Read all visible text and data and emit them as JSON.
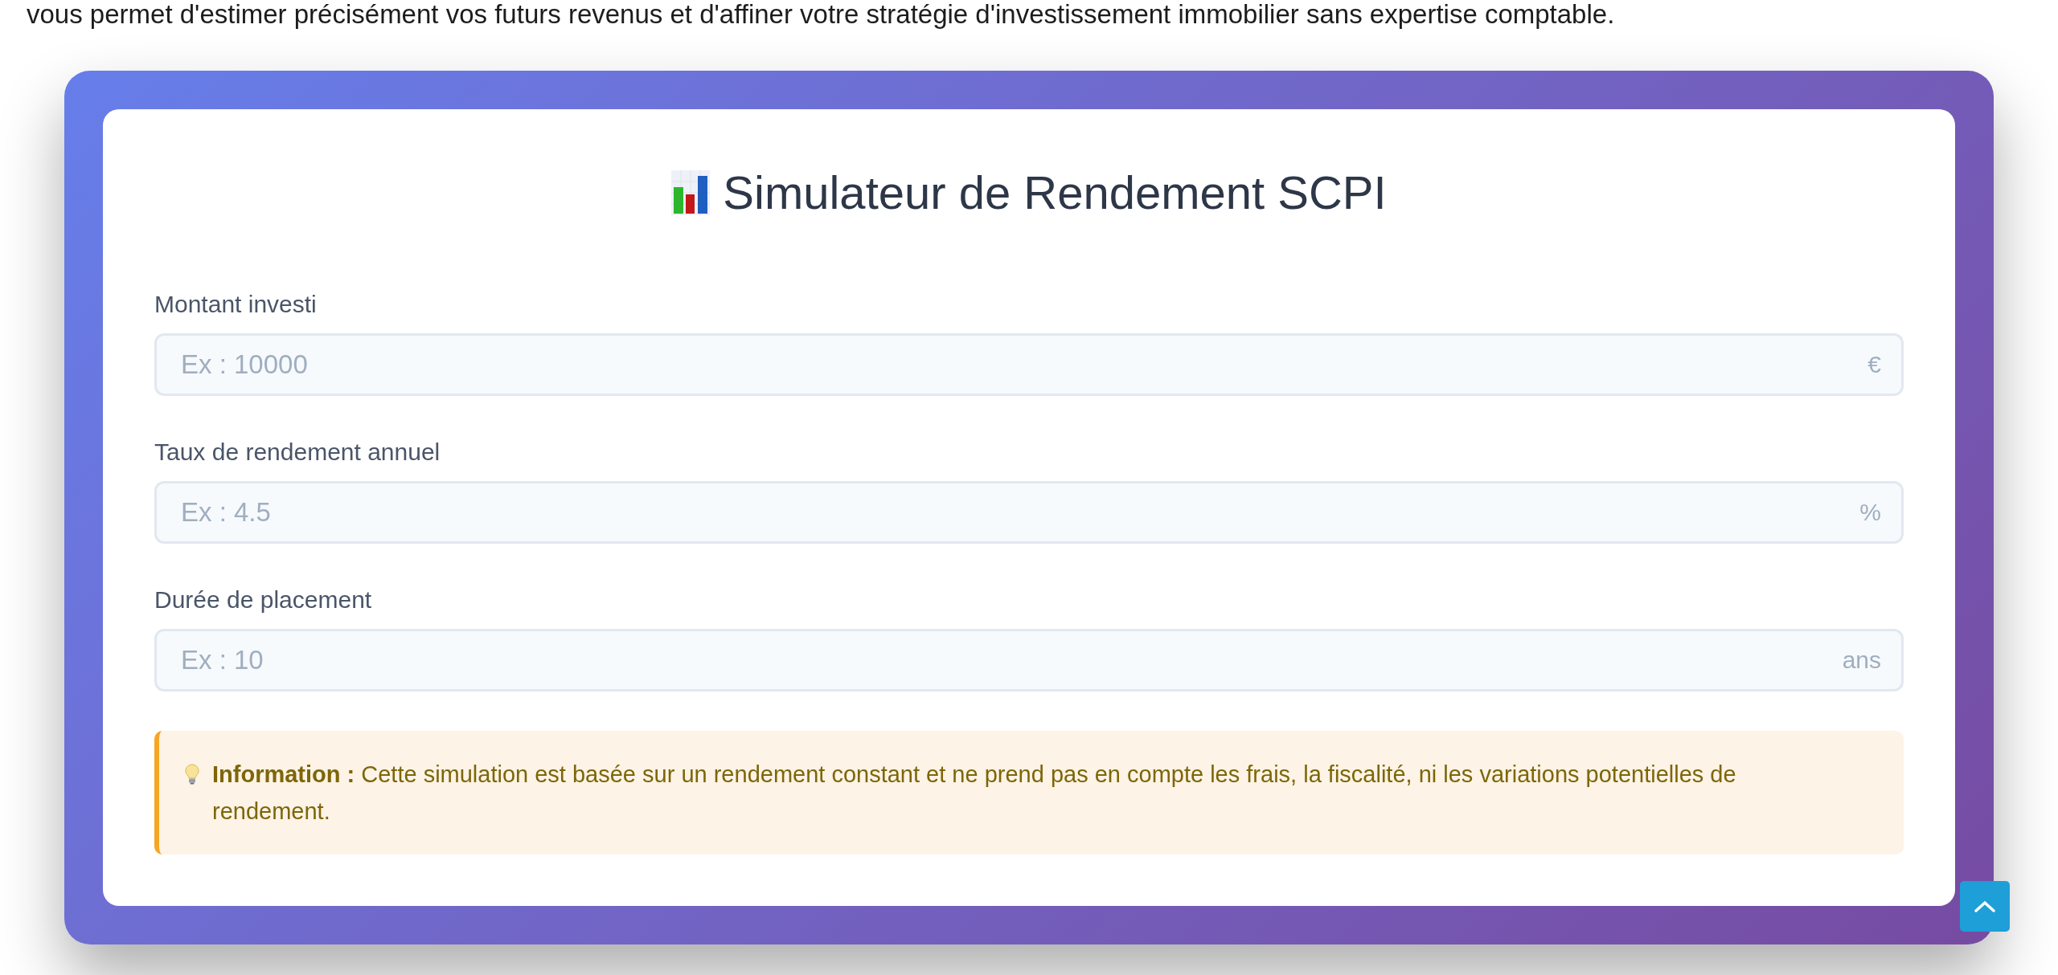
{
  "intro": {
    "text": "vous permet d'estimer précisément vos futurs revenus et d'affiner votre stratégie d'investissement immobilier sans expertise comptable."
  },
  "simulator": {
    "title": "Simulateur de Rendement SCPI",
    "fields": [
      {
        "label": "Montant investi",
        "placeholder": "Ex : 10000",
        "unit": "€"
      },
      {
        "label": "Taux de rendement annuel",
        "placeholder": "Ex : 4.5",
        "unit": "%"
      },
      {
        "label": "Durée de placement",
        "placeholder": "Ex : 10",
        "unit": "ans"
      }
    ],
    "info": {
      "text": "**Information :** Cette simulation est basée sur un rendement constant et ne prend pas en compte les frais, la fiscalité, ni les variations potentielles de rendement."
    }
  }
}
